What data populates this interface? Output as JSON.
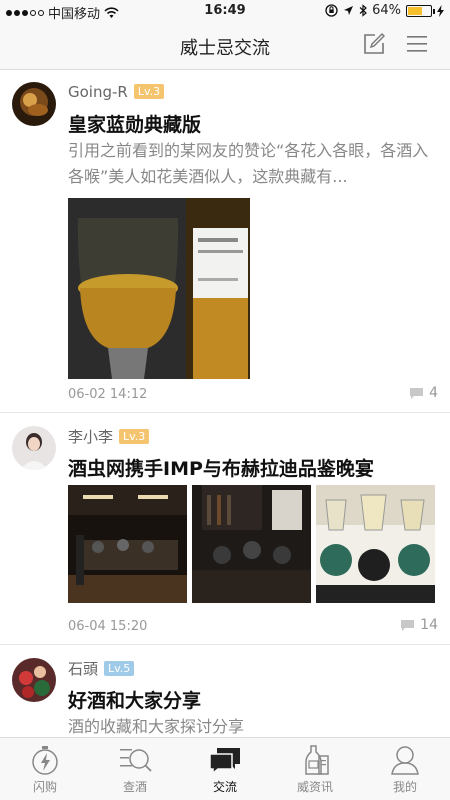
{
  "status_bar": {
    "carrier": "中国移动",
    "time": "16:49",
    "battery": "64%",
    "battery_level": 0.64
  },
  "nav": {
    "title": "威士忌交流",
    "edit_icon": "compose-icon",
    "menu_icon": "menu-icon"
  },
  "posts": [
    {
      "username": "Going-R",
      "level": "Lv.3",
      "title": "皇家蓝勋典藏版",
      "excerpt": "引用之前看到的某网友的赞论“各花入各眼，各酒入各喉”美人如花美酒似人，这款典藏有...",
      "time": "06-02 14:12",
      "comment_count": "4"
    },
    {
      "username": "李小李",
      "level": "Lv.3",
      "title": "酒虫网携手IMP与布赫拉迪品鉴晚宴",
      "time": "06-04 15:20",
      "comment_count": "14"
    },
    {
      "username": "石頭",
      "level": "Lv.5",
      "title": "好酒和大家分享",
      "excerpt": "酒的收藏和大家探讨分享"
    }
  ],
  "tabs": [
    {
      "label": "闪购",
      "icon": "flash-sale-icon"
    },
    {
      "label": "查酒",
      "icon": "search-wine-icon"
    },
    {
      "label": "交流",
      "icon": "chat-icon",
      "active": true
    },
    {
      "label": "威资讯",
      "icon": "news-icon"
    },
    {
      "label": "我的",
      "icon": "profile-icon"
    }
  ],
  "colors": {
    "level_orange": "#f5c46e",
    "level_blue": "#9fcbe8",
    "active_tab": "#111111",
    "inactive_tab": "#888888"
  }
}
